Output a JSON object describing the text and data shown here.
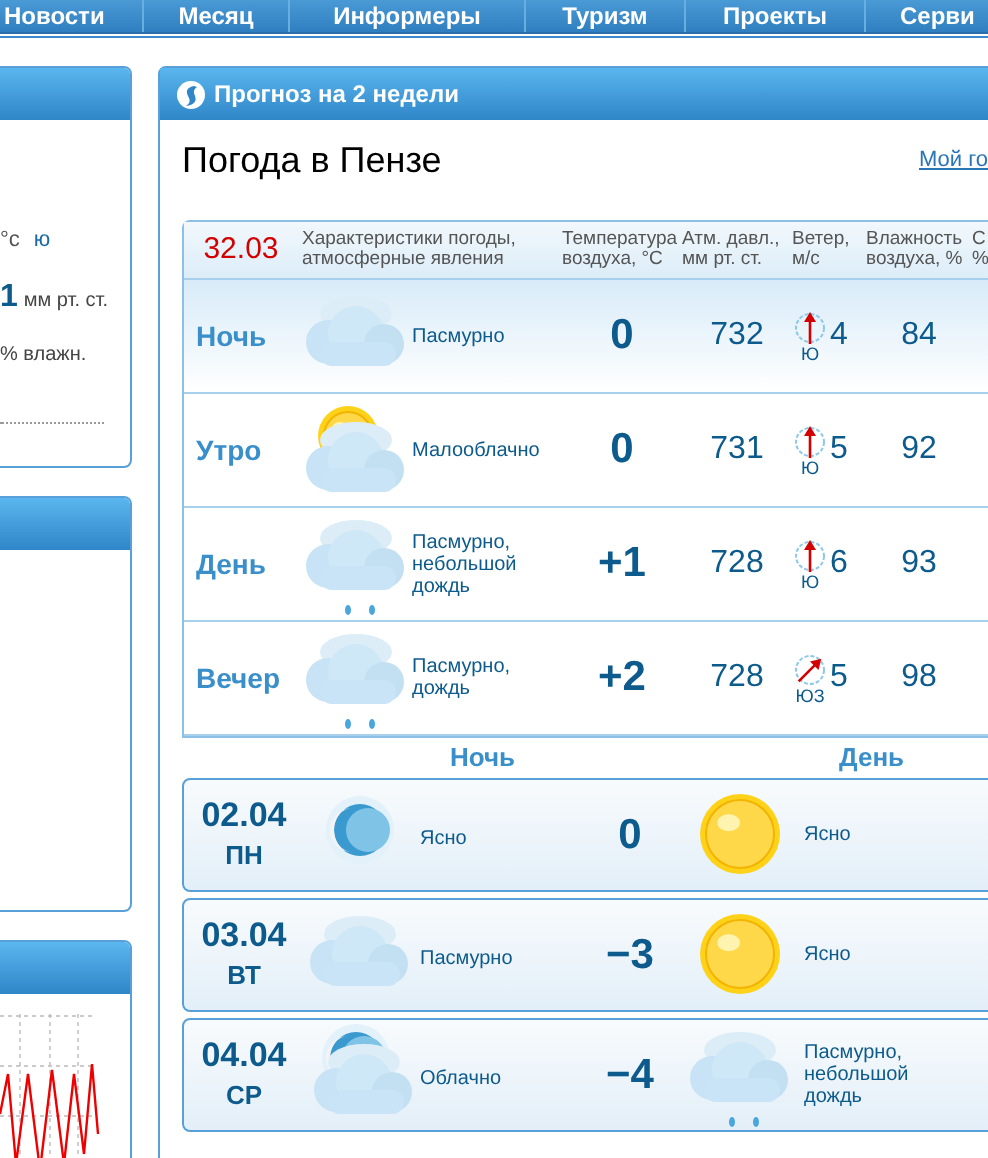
{
  "nav": [
    "Новости",
    "Месяц",
    "Информеры",
    "Туризм",
    "Проекты",
    "Серви"
  ],
  "sidebar": {
    "wind_unit": "°с",
    "wind_dir": "ю",
    "pressure_value": "1",
    "pressure_unit": "мм рт. ст.",
    "humidity_unit": "% влажн."
  },
  "panel": {
    "title": "Прогноз на 2 недели",
    "heading": "Погода в Пензе",
    "link": "Мой го"
  },
  "today": {
    "date": "32.03",
    "columns": [
      [
        "Характеристики погоды,",
        "атмосферные явления"
      ],
      [
        "Температура",
        "воздуха, °С"
      ],
      [
        "Атм. давл.,",
        "мм рт. ст."
      ],
      [
        "Ветер,",
        "м/с"
      ],
      [
        "Влажность",
        "воздуха, %"
      ],
      [
        "С",
        "%"
      ]
    ],
    "rows": [
      {
        "period": "Ночь",
        "current": true,
        "icon": {
          "kind": "overcast"
        },
        "description": "Пасмурно",
        "temp": "0",
        "pressure": "732",
        "wind_arrow": {
          "kind": "north"
        },
        "wind_dir": "Ю",
        "wind_speed": "4",
        "humidity": "84"
      },
      {
        "period": "Утро",
        "current": false,
        "icon": {
          "kind": "partly_cloudy"
        },
        "description": "Малооблачно",
        "temp": "0",
        "pressure": "731",
        "wind_arrow": {
          "kind": "north"
        },
        "wind_dir": "Ю",
        "wind_speed": "5",
        "humidity": "92"
      },
      {
        "period": "День",
        "current": false,
        "icon": {
          "kind": "overcast_rain"
        },
        "description": "Пасмурно, небольшой дождь",
        "temp": "+1",
        "pressure": "728",
        "wind_arrow": {
          "kind": "north"
        },
        "wind_dir": "Ю",
        "wind_speed": "6",
        "humidity": "93"
      },
      {
        "period": "Вечер",
        "current": false,
        "icon": {
          "kind": "overcast_rain"
        },
        "description": "Пасмурно, дождь",
        "temp": "+2",
        "pressure": "728",
        "wind_arrow": {
          "kind": "northeast"
        },
        "wind_dir": "ЮЗ",
        "wind_speed": "5",
        "humidity": "98"
      }
    ]
  },
  "two_weeks": {
    "night_label": "Ночь",
    "day_label": "День",
    "days": [
      {
        "date": "02.04",
        "weekday": "ПН",
        "night_icon": {
          "kind": "clear_night"
        },
        "night_description": "Ясно",
        "temp": "0",
        "day_icon": {
          "kind": "sun"
        },
        "day_description": "Ясно"
      },
      {
        "date": "03.04",
        "weekday": "ВТ",
        "night_icon": {
          "kind": "overcast"
        },
        "night_description": "Пасмурно",
        "temp": "−3",
        "day_icon": {
          "kind": "sun"
        },
        "day_description": "Ясно"
      },
      {
        "date": "04.04",
        "weekday": "СР",
        "night_icon": {
          "kind": "cloudy_night"
        },
        "night_description": "Облачно",
        "temp": "−4",
        "day_icon": {
          "kind": "overcast_rain"
        },
        "day_description": "Пасмурно, небольшой дождь"
      }
    ]
  }
}
